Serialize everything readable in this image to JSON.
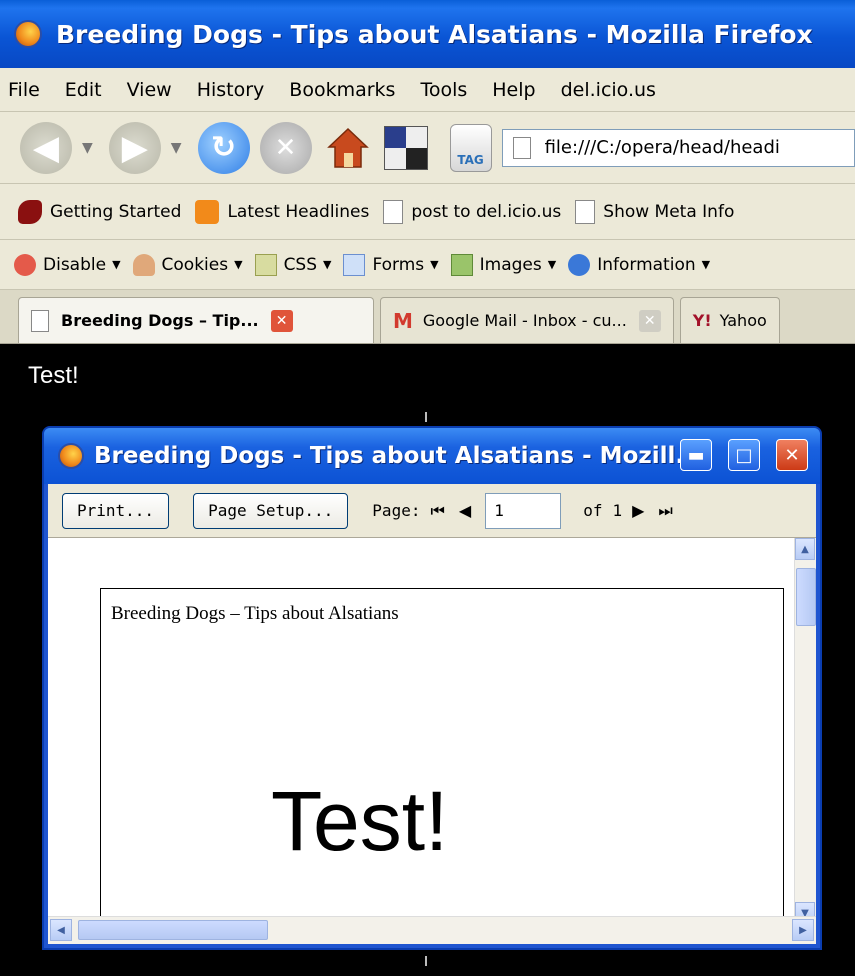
{
  "window": {
    "title": "Breeding Dogs - Tips about Alsatians - Mozilla Firefox"
  },
  "menu": [
    "File",
    "Edit",
    "View",
    "History",
    "Bookmarks",
    "Tools",
    "Help",
    "del.icio.us"
  ],
  "nav": {
    "url": "file:///C:/opera/head/headi",
    "tag_label": "TAG"
  },
  "bookmarks": [
    "Getting Started",
    "Latest Headlines",
    "post to del.icio.us",
    "Show Meta Info"
  ],
  "devtoolbar": [
    "Disable",
    "Cookies",
    "CSS",
    "Forms",
    "Images",
    "Information"
  ],
  "tabs": [
    {
      "label": "Breeding Dogs – Tip..."
    },
    {
      "label": "Google Mail - Inbox - cu..."
    },
    {
      "label": "Yahoo"
    }
  ],
  "page": {
    "body_text": "Test!"
  },
  "preview": {
    "title": "Breeding Dogs - Tips about Alsatians - Mozill...",
    "print_label": "Print...",
    "setup_label": "Page Setup...",
    "page_label": "Page:",
    "page_value": "1",
    "of_label": "of",
    "total_pages": "1",
    "paper_header": "Breeding Dogs – Tips about Alsatians",
    "paper_body": "Test!"
  }
}
